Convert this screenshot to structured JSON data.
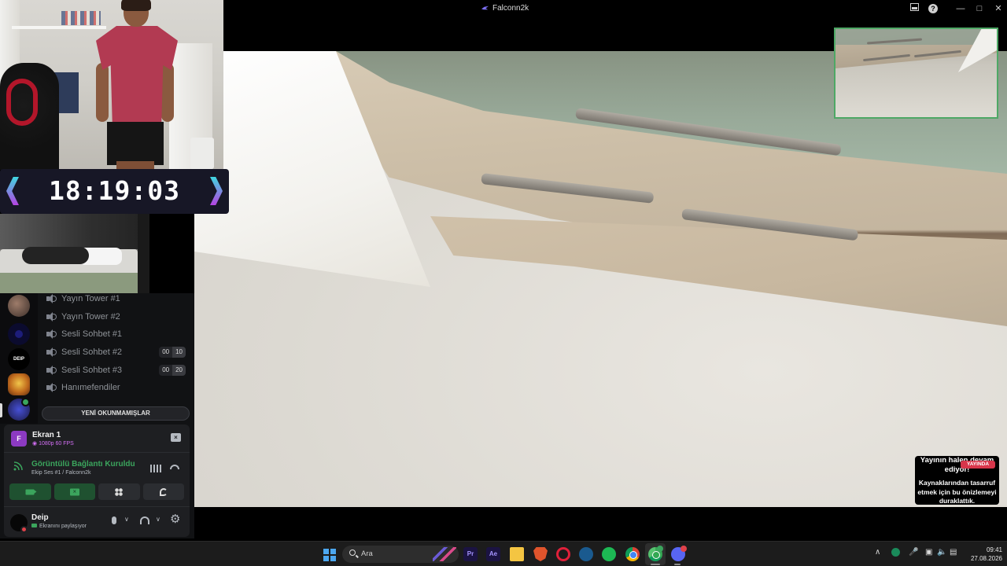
{
  "window": {
    "title": "Falconn2k"
  },
  "webcam": {
    "timer": "18:19:03"
  },
  "sidebar": {
    "servers": [
      {
        "name": "server-avatar-1"
      },
      {
        "name": "server-avatar-2"
      },
      {
        "label": "DEIP"
      },
      {
        "name": "server-avatar-4"
      },
      {
        "name": "server-avatar-5"
      }
    ],
    "channels": [
      {
        "label": "Yayın Tower #1"
      },
      {
        "label": "Yayın Tower #2"
      },
      {
        "label": "Sesli Sohbet #1"
      },
      {
        "label": "Sesli Sohbet #2",
        "count": "00",
        "limit": "10"
      },
      {
        "label": "Sesli Sohbet #3",
        "count": "00",
        "limit": "20"
      },
      {
        "label": "Hanımefendiler"
      }
    ],
    "unread_button": "YENİ OKUNMAMIŞLAR"
  },
  "stream_card": {
    "icon_letter": "F",
    "title": "Ekran 1",
    "quality": "1080p 60 FPS"
  },
  "voice": {
    "status": "Görüntülü Bağlantı Kuruldu",
    "channel": "Ekip Ses #1 / Falconn2k"
  },
  "user": {
    "name": "Deip",
    "status": "Ekranını paylaşıyor"
  },
  "notice": {
    "title": "Yayının halen devam ediyor!",
    "live_badge": "YAYINDA",
    "body": "Kaynaklarından tasarruf etmek için bu önizlemeyi duraklattık."
  },
  "taskbar": {
    "search_placeholder": "Ara",
    "pr_label": "Pr",
    "ae_label": "Ae",
    "time": "09:41",
    "date": "27.08.2026"
  },
  "colors": {
    "accent_green": "#3ba55d",
    "live_red": "#d8364b",
    "stream_purple": "#8c3ac2"
  }
}
